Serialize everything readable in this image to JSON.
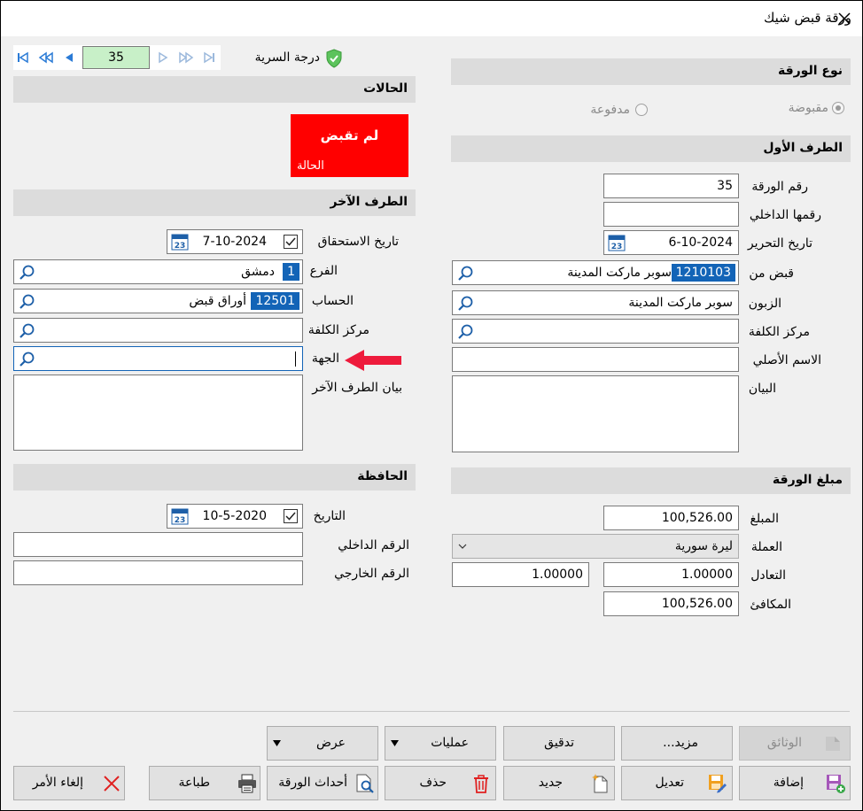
{
  "window": {
    "title": "ورقة قبض شيك"
  },
  "nav": {
    "record_number": "35"
  },
  "security": {
    "label": "درجة السرية"
  },
  "paper_type": {
    "header": "نوع الورقة",
    "option_received": "مقبوضة",
    "option_paid": "مدفوعة",
    "selected": "مقبوضة"
  },
  "statuses": {
    "header": "الحالات",
    "status_value": "لم تقبض",
    "status_label": "الحالة",
    "status_color": "#ff0000"
  },
  "first_party": {
    "header": "الطرف الأول",
    "paper_number_label": "رقم الورقة",
    "paper_number": "35",
    "internal_number_label": "رقمها الداخلي",
    "internal_number": "",
    "issue_date_label": "تاريخ التحرير",
    "issue_date": "6-10-2024",
    "received_from_label": "قبض من",
    "received_from_code": "1210103",
    "received_from_name": "سوبر ماركت المدينة",
    "customer_label": "الزبون",
    "customer": "سوبر ماركت المدينة",
    "cost_center_label": "مركز الكلفة",
    "cost_center": "",
    "original_name_label": "الاسم الأصلي",
    "original_name": "",
    "statement_label": "البيان",
    "statement": ""
  },
  "other_party": {
    "header": "الطرف الآخر",
    "due_date_label": "تاريخ الاستحقاق",
    "due_date": "7-10-2024",
    "branch_label": "الفرع",
    "branch_code": "1",
    "branch_name": "دمشق",
    "account_label": "الحساب",
    "account_code": "12501",
    "account_name": "أوراق قبض",
    "cost_center_label": "مركز الكلفة",
    "cost_center": "",
    "party_label": "الجهة",
    "party": "",
    "statement_label": "بيان الطرف الآخر",
    "statement": ""
  },
  "portfolio": {
    "header": "الحافظة",
    "date_label": "التاريخ",
    "date": "10-5-2020",
    "internal_number_label": "الرقم الداخلي",
    "internal_number": "",
    "external_number_label": "الرقم الخارجي",
    "external_number": ""
  },
  "amount": {
    "header": "مبلغ الورقة",
    "amount_label": "المبلغ",
    "amount": "100,526.00",
    "currency_label": "العملة",
    "currency": "ليرة سورية",
    "rate_label": "التعادل",
    "rate": "1.00000",
    "rate2": "1.00000",
    "equivalent_label": "المكافئ",
    "equivalent": "100,526.00"
  },
  "buttons": {
    "documents": "الوثائق",
    "more": "مزيد...",
    "audit": "تدقيق",
    "operations": "عمليات",
    "view": "عرض",
    "add": "إضافة",
    "edit": "تعديل",
    "new": "جديد",
    "delete": "حذف",
    "events": "أحداث الورقة",
    "print": "طباعة",
    "cancel": "إلغاء الأمر"
  }
}
